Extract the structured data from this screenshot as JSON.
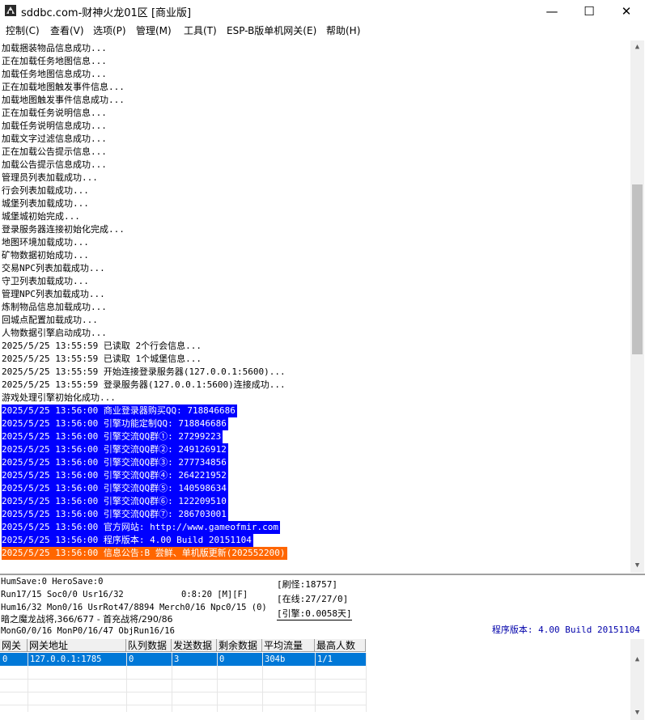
{
  "window": {
    "title": "sddbc.com-财神火龙01区 [商业版]",
    "minimize": "—",
    "maximize": "☐",
    "close": "✕"
  },
  "menu": [
    "控制(C)",
    "查看(V)",
    "选项(P)",
    "管理(M)",
    "工具(T)",
    "ESP-B版单机网关(E)",
    "帮助(H)"
  ],
  "log": [
    {
      "text": "加载捆装物品信息成功...",
      "style": ""
    },
    {
      "text": "正在加载任务地图信息...",
      "style": ""
    },
    {
      "text": "加载任务地图信息成功...",
      "style": ""
    },
    {
      "text": "正在加载地图触发事件信息...",
      "style": ""
    },
    {
      "text": "加载地图触发事件信息成功...",
      "style": ""
    },
    {
      "text": "正在加载任务说明信息...",
      "style": ""
    },
    {
      "text": "加载任务说明信息成功...",
      "style": ""
    },
    {
      "text": "加载文字过滤信息成功...",
      "style": ""
    },
    {
      "text": "正在加载公告提示信息...",
      "style": ""
    },
    {
      "text": "加载公告提示信息成功...",
      "style": ""
    },
    {
      "text": "管理员列表加载成功...",
      "style": ""
    },
    {
      "text": "行会列表加载成功...",
      "style": ""
    },
    {
      "text": "城堡列表加载成功...",
      "style": ""
    },
    {
      "text": "城堡城初始完成...",
      "style": ""
    },
    {
      "text": "登录服务器连接初始化完成...",
      "style": ""
    },
    {
      "text": "地图环境加载成功...",
      "style": ""
    },
    {
      "text": "矿物数据初始成功...",
      "style": ""
    },
    {
      "text": "交易NPC列表加载成功...",
      "style": ""
    },
    {
      "text": "守卫列表加载成功...",
      "style": ""
    },
    {
      "text": "管理NPC列表加载成功...",
      "style": ""
    },
    {
      "text": "炼制物品信息加载成功...",
      "style": ""
    },
    {
      "text": "回城点配置加载成功...",
      "style": ""
    },
    {
      "text": "人物数据引擎启动成功...",
      "style": ""
    },
    {
      "text": "2025/5/25 13:55:59 已读取 2个行会信息...",
      "style": ""
    },
    {
      "text": "2025/5/25 13:55:59 已读取 1个城堡信息...",
      "style": ""
    },
    {
      "text": "2025/5/25 13:55:59 开始连接登录服务器(127.0.0.1:5600)...",
      "style": ""
    },
    {
      "text": "2025/5/25 13:55:59 登录服务器(127.0.0.1:5600)连接成功...",
      "style": ""
    },
    {
      "text": "游戏处理引擎初始化成功...",
      "style": ""
    },
    {
      "text": "2025/5/25 13:56:00 商业登录器购买QQ: 718846686",
      "style": "blue"
    },
    {
      "text": "2025/5/25 13:56:00 引擎功能定制QQ: 718846686",
      "style": "blue"
    },
    {
      "text": "2025/5/25 13:56:00 引擎交流QQ群①: 27299223",
      "style": "blue"
    },
    {
      "text": "2025/5/25 13:56:00 引擎交流QQ群②: 249126912",
      "style": "blue"
    },
    {
      "text": "2025/5/25 13:56:00 引擎交流QQ群③: 277734856",
      "style": "blue"
    },
    {
      "text": "2025/5/25 13:56:00 引擎交流QQ群④: 264221952",
      "style": "blue"
    },
    {
      "text": "2025/5/25 13:56:00 引擎交流QQ群⑤: 140598634",
      "style": "blue"
    },
    {
      "text": "2025/5/25 13:56:00 引擎交流QQ群⑥: 122209510",
      "style": "blue"
    },
    {
      "text": "2025/5/25 13:56:00 引擎交流QQ群⑦: 286703001",
      "style": "blue"
    },
    {
      "text": "2025/5/25 13:56:00 官方网站: http://www.gameofmir.com",
      "style": "blue"
    },
    {
      "text": "2025/5/25 13:56:00 程序版本: 4.00 Build 20151104",
      "style": "blue"
    },
    {
      "text": "2025/5/25 13:56:00 信息公告:B 尝鲜、单机版更新(202552200)",
      "style": "orange"
    }
  ],
  "status": {
    "line1": "HumSave:0 HeroSave:0",
    "line2": "Run17/15 Soc0/0 Usr16/32",
    "line2b": "0:8:20 [M][F]",
    "line3": "Hum16/32 Mon0/16 UsrRot47/8894 Merch0/16 Npc0/15 (0)",
    "line4": "暗之魔龙战将,366/677 - 首充战将/290/86",
    "line5": "MonG0/0/16 MonP0/16/47 ObjRun16/16",
    "refresh": "[刷怪:18757]",
    "online": "[在线:27/27/0]",
    "engine": "[引擎:0.0058天]",
    "version": "程序版本: 4.00 Build 20151104"
  },
  "table": {
    "headers": [
      "网关",
      "网关地址",
      "队列数据",
      "发送数据",
      "剩余数据",
      "平均流量",
      "最高人数"
    ],
    "rows": [
      [
        "0",
        "127.0.0.1:1785",
        "0",
        "3",
        "0",
        "304b",
        "1/1"
      ]
    ]
  }
}
